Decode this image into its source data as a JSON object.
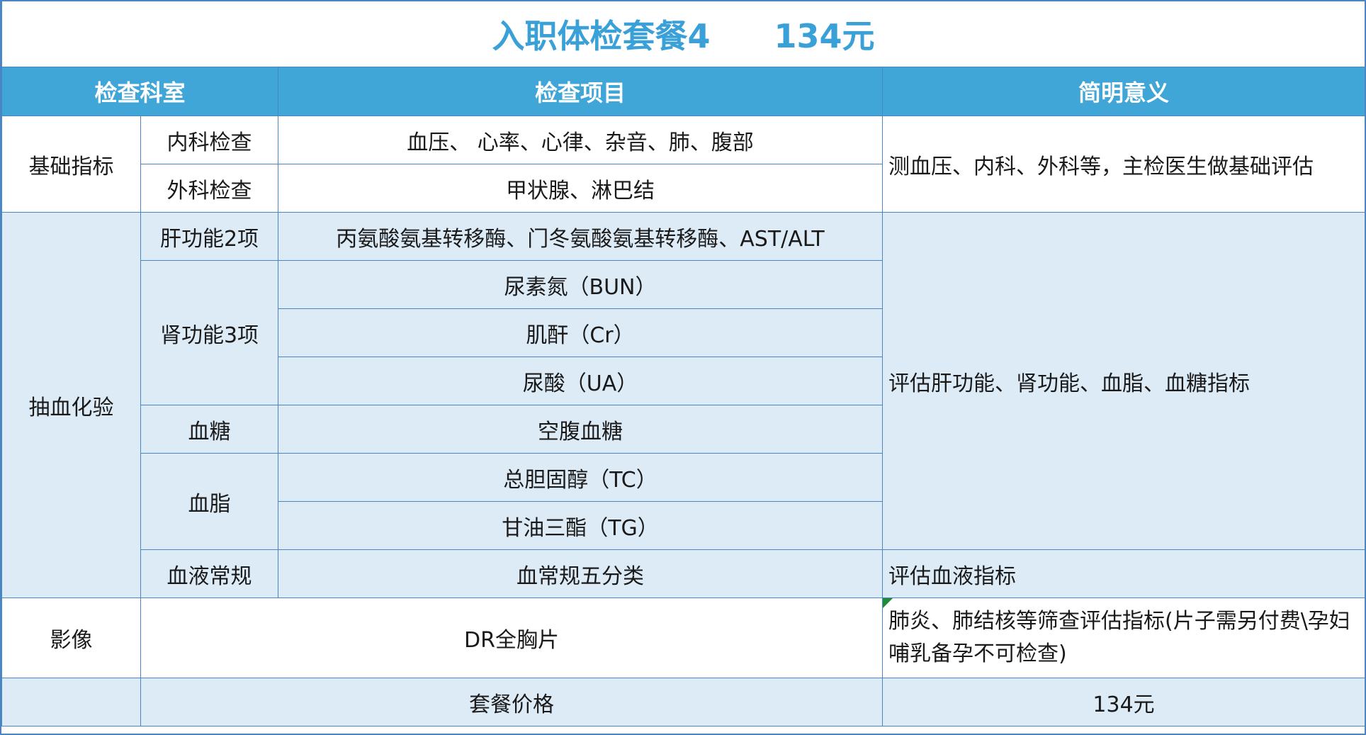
{
  "title": {
    "name": "入职体检套餐4",
    "price": "134元"
  },
  "header": {
    "dept": "检查科室",
    "items": "检查项目",
    "meaning": "简明意义"
  },
  "basic": {
    "group": "基础指标",
    "sub1": "内科检查",
    "sub1_items": "血压、 心率、心律、杂音、肺、腹部",
    "sub2": "外科检查",
    "sub2_items": "甲状腺、淋巴结",
    "meaning": "测血压、内科、外科等，主检医生做基础评估"
  },
  "blood": {
    "group": "抽血化验",
    "liver": "肝功能2项",
    "liver_items": "丙氨酸氨基转移酶、门冬氨酸氨基转移酶、AST/ALT",
    "kidney": "肾功能3项",
    "kidney_item1": "尿素氮（BUN）",
    "kidney_item2": "肌酐（Cr）",
    "kidney_item3": "尿酸（UA）",
    "sugar": "血糖",
    "sugar_item": "空腹血糖",
    "lipid": "血脂",
    "lipid_item1": "总胆固醇（TC）",
    "lipid_item2": "甘油三酯（TG）",
    "meaning": "评估肝功能、肾功能、血脂、血糖指标",
    "routine": "血液常规",
    "routine_item": "血常规五分类",
    "routine_meaning": "评估血液指标"
  },
  "imaging": {
    "group": "影像",
    "item": "DR全胸片",
    "meaning": "肺炎、肺结核等筛查评估指标(片子需另付费\\孕妇哺乳备孕不可检查)"
  },
  "footer": {
    "label": "套餐价格",
    "price": "134元"
  },
  "colors": {
    "accent": "#3fa6d7",
    "title": "#3aa0d8",
    "band": "#ddebf6",
    "border": "#4a86c5"
  }
}
